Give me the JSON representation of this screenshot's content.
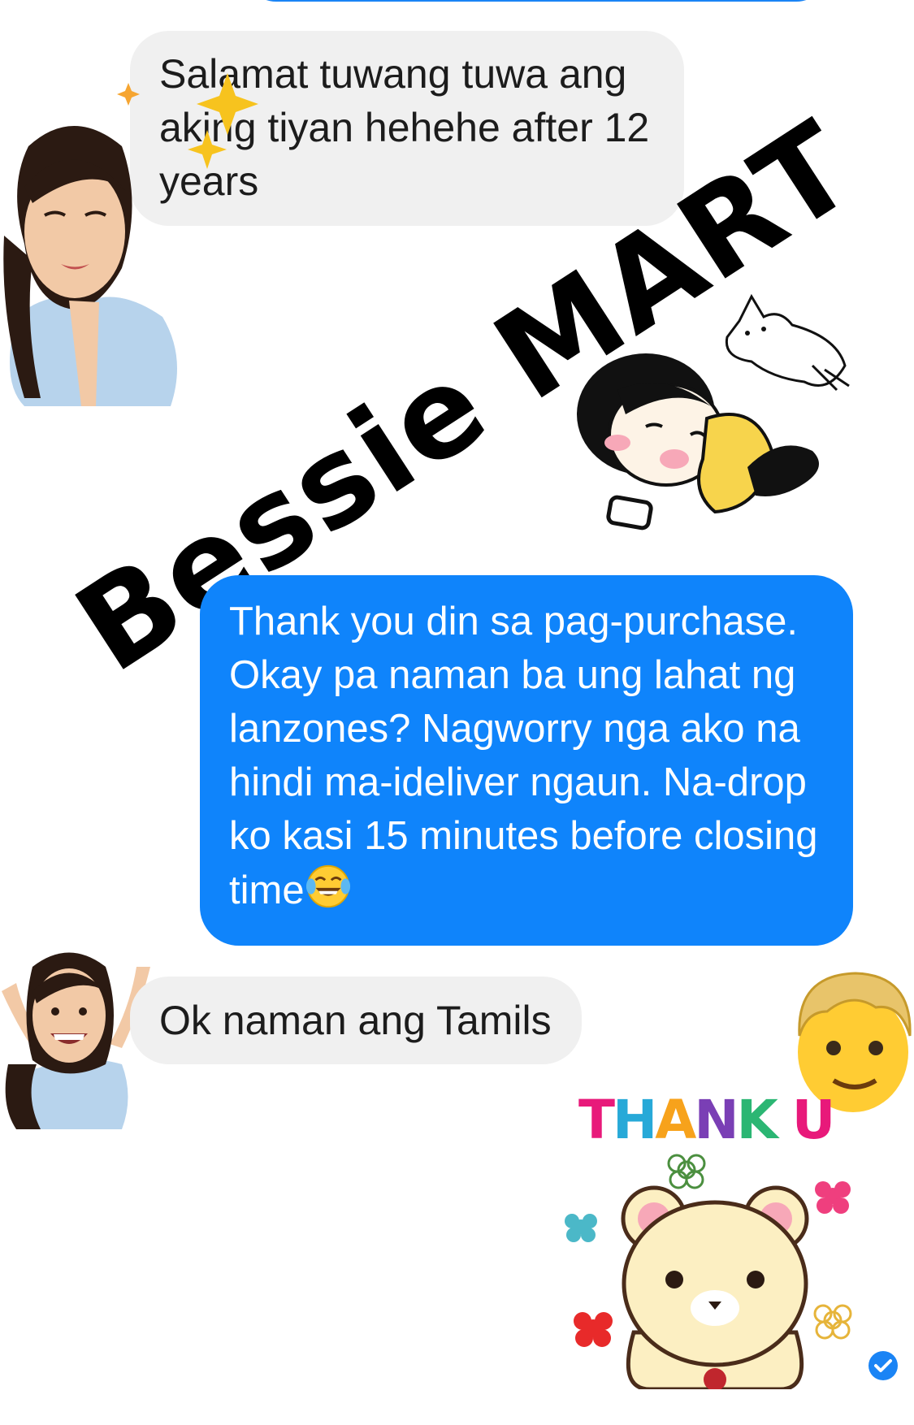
{
  "conversation": {
    "messages": [
      {
        "sender": "contact",
        "text": "Salamat tuwang tuwa ang aking tiyan hehehe after 12 years"
      },
      {
        "sender": "me",
        "text": "Thank you din sa pag-purchase. Okay pa naman ba ung lahat ng lanzones? Nagworry nga ako na hindi ma-ideliver ngaun. Na-drop ko kasi 15 minutes before closing time",
        "trailing_emoji": "tears-of-joy-emoji"
      },
      {
        "sender": "contact",
        "text": "Ok naman ang Tamils"
      }
    ]
  },
  "watermark": {
    "text": "Bessie MART"
  },
  "stickers": {
    "thank_you_sticker": {
      "text_letters": [
        "T",
        "H",
        "A",
        "N",
        "K",
        " ",
        "U"
      ],
      "letter_colors": [
        "#e8197a",
        "#27a9d8",
        "#f7a21b",
        "#7a3fb5",
        "#2bb673",
        "#ffffff",
        "#e8197a"
      ]
    },
    "icons": [
      "sparkles-icon",
      "praying-avatar-sticker",
      "girl-sticker",
      "cat-sticker",
      "cheering-avatar-sticker",
      "man-emoji",
      "bear-sticker",
      "seen-check-icon"
    ]
  },
  "colors": {
    "incoming_bubble": "#f0f0f0",
    "outgoing_bubble": "#0f84fb",
    "seen_check": "#1a84f5"
  }
}
